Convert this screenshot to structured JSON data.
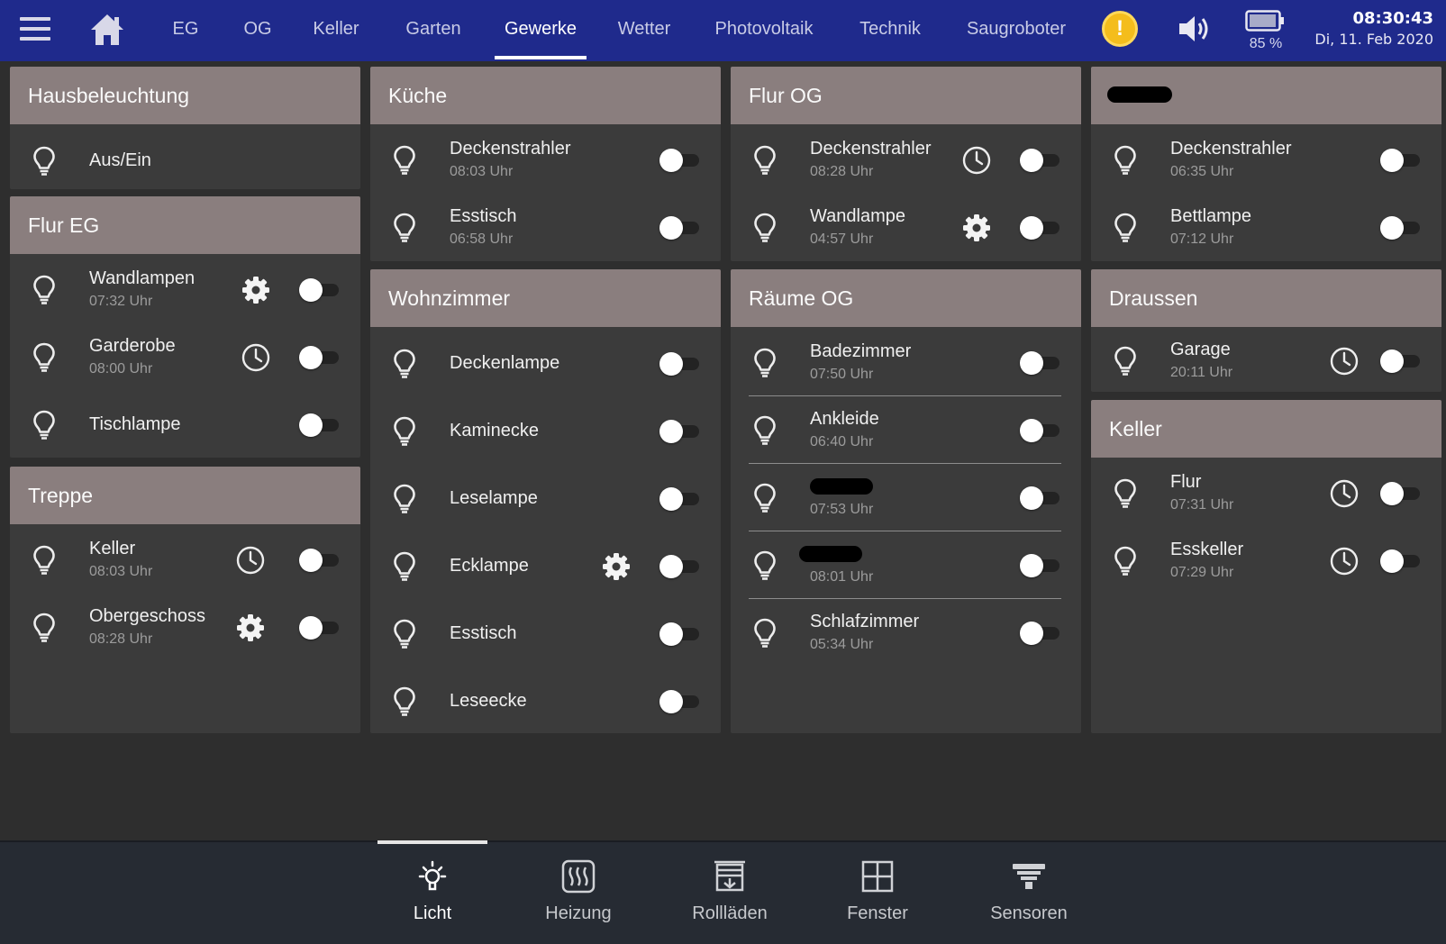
{
  "topbar": {
    "tabs": [
      "EG",
      "OG",
      "Keller",
      "Garten",
      "Gewerke",
      "Wetter",
      "Photovoltaik",
      "Technik",
      "Saugroboter"
    ],
    "active_tab": "Gewerke",
    "warning_symbol": "!",
    "battery_percent": "85 %",
    "time": "08:30:43",
    "date": "Di, 11. Feb 2020",
    "bar_color": "#1f2a8c"
  },
  "cards": {
    "hausbeleuchtung": {
      "title": "Hausbeleuchtung",
      "rows": [
        {
          "name": "Aus/Ein"
        }
      ]
    },
    "flur_eg": {
      "title": "Flur EG",
      "rows": [
        {
          "name": "Wandlampen",
          "time": "07:32 Uhr",
          "icon": "gear-icon"
        },
        {
          "name": "Garderobe",
          "time": "08:00 Uhr",
          "icon": "clock-icon"
        },
        {
          "name": "Tischlampe"
        }
      ]
    },
    "treppe": {
      "title": "Treppe",
      "rows": [
        {
          "name": "Keller",
          "time": "08:03 Uhr",
          "icon": "clock-icon"
        },
        {
          "name": "Obergeschoss",
          "time": "08:28 Uhr",
          "icon": "gear-icon"
        }
      ]
    },
    "kueche": {
      "title": "Küche",
      "rows": [
        {
          "name": "Deckenstrahler",
          "time": "08:03 Uhr"
        },
        {
          "name": "Esstisch",
          "time": "06:58 Uhr"
        }
      ]
    },
    "wohnzimmer": {
      "title": "Wohnzimmer",
      "rows": [
        {
          "name": "Deckenlampe"
        },
        {
          "name": "Kaminecke"
        },
        {
          "name": "Leselampe"
        },
        {
          "name": "Ecklampe",
          "icon": "gear-icon"
        },
        {
          "name": "Esstisch"
        },
        {
          "name": "Leseecke"
        }
      ]
    },
    "flur_og": {
      "title": "Flur OG",
      "rows": [
        {
          "name": "Deckenstrahler",
          "time": "08:28 Uhr",
          "icon": "clock-icon"
        },
        {
          "name": "Wandlampe",
          "time": "04:57 Uhr",
          "icon": "gear-icon"
        }
      ]
    },
    "raeume_og": {
      "title": "Räume OG",
      "rows": [
        {
          "name": "Badezimmer",
          "time": "07:50 Uhr"
        },
        {
          "name": "Ankleide",
          "time": "06:40 Uhr"
        },
        {
          "name": "",
          "time": "07:53 Uhr",
          "redacted": true
        },
        {
          "name": "",
          "time": "08:01 Uhr",
          "redacted": true
        },
        {
          "name": "Schlafzimmer",
          "time": "05:34 Uhr"
        }
      ]
    },
    "zimmer4": {
      "title": "",
      "rows": [
        {
          "name": "Deckenstrahler",
          "time": "06:35 Uhr"
        },
        {
          "name": "Bettlampe",
          "time": "07:12 Uhr"
        }
      ]
    },
    "draussen": {
      "title": "Draussen",
      "rows": [
        {
          "name": "Garage",
          "time": "20:11 Uhr",
          "icon": "clock-icon"
        }
      ]
    },
    "keller": {
      "title": "Keller",
      "rows": [
        {
          "name": "Flur",
          "time": "07:31 Uhr",
          "icon": "clock-icon"
        },
        {
          "name": "Esskeller",
          "time": "07:29 Uhr",
          "icon": "clock-icon"
        }
      ]
    }
  },
  "bottombar": {
    "items": [
      "Licht",
      "Heizung",
      "Rollläden",
      "Fenster",
      "Sensoren"
    ],
    "active": "Licht"
  }
}
